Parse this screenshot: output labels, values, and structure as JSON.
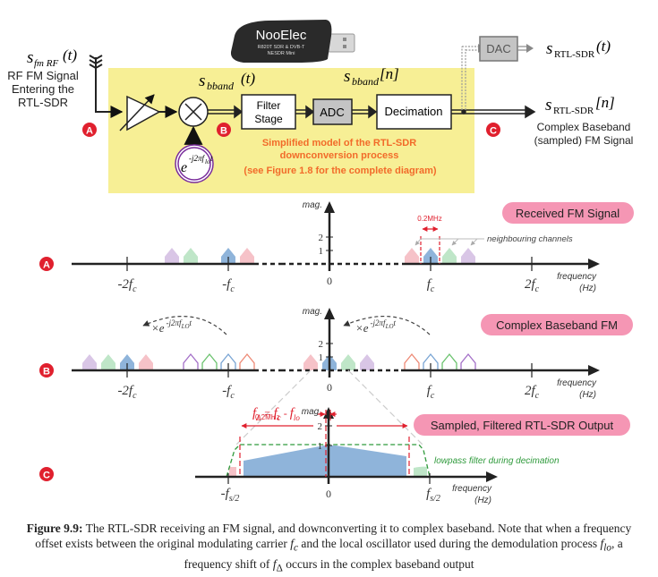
{
  "block_diagram": {
    "input_signal": {
      "symbol": "s",
      "subscript": "fm RF",
      "arg": "(t)"
    },
    "input_label": [
      "RF FM Signal",
      "Entering the",
      "RTL-SDR"
    ],
    "device": {
      "brand": "NooElec",
      "line1": "R820T SDR & DVB-T",
      "line2": "NESDR Mini"
    },
    "signal_bband_t": {
      "symbol": "s",
      "subscript": "bband",
      "arg": "(t)"
    },
    "signal_bband_n": {
      "symbol": "s",
      "subscript": "bband",
      "arg": "[n]"
    },
    "oscillator": {
      "base": "e",
      "exponent": "-j2πf",
      "exp_sub": "lo",
      "exp_tail": "t"
    },
    "blocks": {
      "filter": [
        "Filter",
        "Stage"
      ],
      "adc": "ADC",
      "decimation": "Decimation",
      "dac": "DAC"
    },
    "model_note": [
      "Simplified model of the RTL-SDR",
      "downconversion process",
      "(see Figure 1.8 for the complete diagram)"
    ],
    "output_analog": {
      "symbol": "s",
      "subscript": "RTL-SDR",
      "arg": "(t)"
    },
    "output_digital": {
      "symbol": "s",
      "subscript": "RTL-SDR",
      "arg": "[n]"
    },
    "output_label": [
      "Complex Baseband",
      "(sampled) FM Signal"
    ],
    "markers": {
      "a": "A",
      "b": "B",
      "c": "C"
    }
  },
  "colors": {
    "panel_yellow": "#f7ef95",
    "marker_red": "#e0202e",
    "note_orange": "#f26b2a",
    "pill_pink": "#f596b4",
    "annot_red": "#e0202e",
    "filter_green": "#2f9a3c",
    "ch_purple": "#d9c6e6",
    "ch_green": "#bfe6c8",
    "ch_blue": "#8fb4da",
    "ch_pink": "#f6c2c8",
    "outline_purple": "#a470c8",
    "outline_green": "#6cc36f",
    "outline_blue": "#7aa5d4",
    "outline_orange": "#ee8a76"
  },
  "chart_data": [
    {
      "type": "spectrum",
      "marker": "A",
      "title": "Received FM Signal",
      "ylabel": "mag.",
      "xlabel": [
        "frequency",
        "(Hz)"
      ],
      "yticks": [
        "1",
        "2"
      ],
      "xticks": [
        "-2f_c",
        "-f_c",
        "0",
        "f_c",
        "2f_c"
      ],
      "channel_spacing_label": "0.2MHz",
      "annotation": "neighbouring channels",
      "channels_negative": [
        {
          "color": "purple",
          "offset_MHz": -0.6
        },
        {
          "color": "green",
          "offset_MHz": -0.4
        },
        {
          "color": "blue",
          "offset_MHz": 0.0
        },
        {
          "color": "pink",
          "offset_MHz": 0.2
        }
      ],
      "channels_positive": [
        {
          "color": "pink",
          "offset_MHz": -0.2
        },
        {
          "color": "blue",
          "offset_MHz": 0.0
        },
        {
          "color": "green",
          "offset_MHz": 0.2
        },
        {
          "color": "purple",
          "offset_MHz": 0.4
        }
      ]
    },
    {
      "type": "spectrum",
      "marker": "B",
      "title": "Complex Baseband FM",
      "ylabel": "mag.",
      "xlabel": [
        "frequency",
        "(Hz)"
      ],
      "yticks": [
        "1",
        "2"
      ],
      "xticks": [
        "-2f_c",
        "-f_c",
        "0",
        "f_c",
        "2f_c"
      ],
      "shift_label": {
        "prefix": "×e",
        "exponent": "-j2πf",
        "exp_sub": "LO",
        "exp_tail": "t"
      }
    },
    {
      "type": "spectrum",
      "marker": "C",
      "title": "Sampled, Filtered RTL-SDR Output",
      "ylabel": "mag.",
      "xlabel": [
        "frequency",
        "(Hz)"
      ],
      "yticks": [
        "1",
        "2"
      ],
      "xticks": [
        "-f_s/2",
        "0",
        "f_s/2"
      ],
      "offset_label": {
        "lhs": "f",
        "lhs_sub": "Δ",
        "rhs1": "f",
        "rhs1_sub": "c",
        "rhs2": "f",
        "rhs2_sub": "lo"
      },
      "bandwidth_label": "0.2MHz",
      "filter_label": "lowpass filter during decimation",
      "baseband_peak_mag": 1
    }
  ],
  "caption": {
    "label": "Figure 9.9:",
    "text1": " The RTL-SDR receiving an FM signal, and downconverting it to complex baseband. Note that when a frequency offset exists between the original modulating carrier ",
    "fc": "f",
    "fc_sub": "c",
    "text2": " and the local oscillator used during the demodulation process ",
    "flo": "f",
    "flo_sub": "lo",
    "text3": ", a frequency shift of ",
    "fd": "f",
    "fd_sub": "Δ",
    "text4": " occurs in the complex baseband output"
  }
}
